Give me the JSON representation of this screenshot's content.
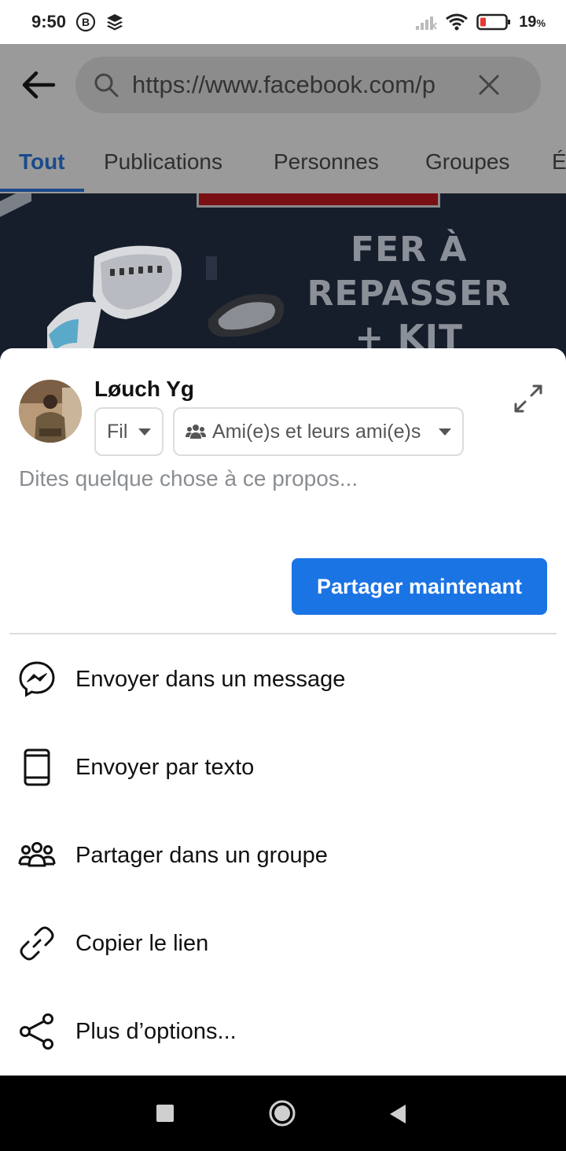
{
  "status_bar": {
    "time": "9:50",
    "battery_percent": "19",
    "battery_unit": "%",
    "icons": [
      "b-badge-icon",
      "layers-icon",
      "signal-icon",
      "wifi-icon",
      "battery-low-icon"
    ],
    "battery_color": "#e53935"
  },
  "browser": {
    "url": "https://www.facebook.com/p",
    "tabs": [
      "Tout",
      "Publications",
      "Personnes",
      "Groupes",
      "É"
    ],
    "active_tab": "Tout",
    "banner_text": [
      "FER À",
      "REPASSER",
      "+ KIT"
    ]
  },
  "share_sheet": {
    "user_name": "Løuch Yg",
    "destination": "Fil",
    "audience": "Ami(e)s et leurs ami(e)s",
    "placeholder": "Dites quelque chose à ce propos...",
    "share_now_label": "Partager maintenant",
    "accent_color": "#1b74e4",
    "options": [
      {
        "label": "Envoyer dans un message",
        "icon": "messenger-icon"
      },
      {
        "label": "Envoyer par texto",
        "icon": "phone-icon"
      },
      {
        "label": "Partager dans un groupe",
        "icon": "group-icon"
      },
      {
        "label": "Copier le lien",
        "icon": "link-icon"
      },
      {
        "label": "Plus d’options...",
        "icon": "share-icon"
      }
    ]
  },
  "nav_bar": {
    "buttons": [
      "recents-button",
      "home-button",
      "back-button"
    ]
  }
}
